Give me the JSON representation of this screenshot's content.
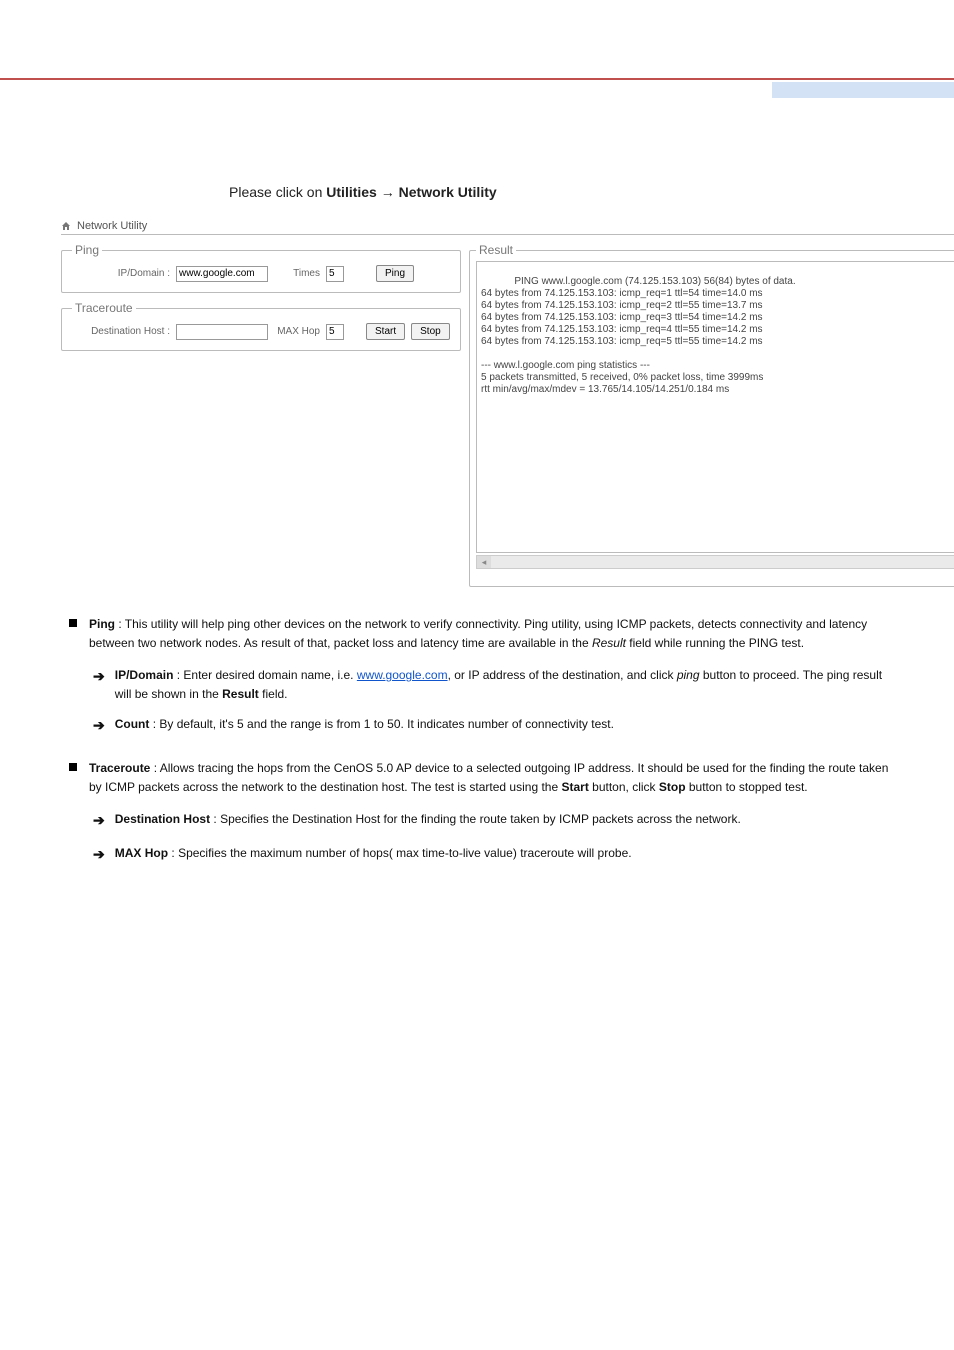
{
  "heading": {
    "prefix": "Please click on ",
    "path_bold_1": "Utilities",
    "arrow": " → ",
    "path_bold_2": "Network Utility"
  },
  "panel": {
    "title": "Network Utility",
    "ping": {
      "legend": "Ping",
      "ip_label": "IP/Domain :",
      "ip_value": "www.google.com",
      "times_label": "Times",
      "times_value": "5",
      "button": "Ping"
    },
    "trace": {
      "legend": "Traceroute",
      "host_label": "Destination Host :",
      "host_value": "",
      "maxhop_label": "MAX Hop",
      "maxhop_value": "5",
      "start": "Start",
      "stop": "Stop"
    },
    "result": {
      "legend": "Result",
      "text": "PING www.l.google.com (74.125.153.103) 56(84) bytes of data.\n64 bytes from 74.125.153.103: icmp_req=1 ttl=54 time=14.0 ms\n64 bytes from 74.125.153.103: icmp_req=2 ttl=55 time=13.7 ms\n64 bytes from 74.125.153.103: icmp_req=3 ttl=54 time=14.2 ms\n64 bytes from 74.125.153.103: icmp_req=4 ttl=55 time=14.2 ms\n64 bytes from 74.125.153.103: icmp_req=5 ttl=55 time=14.2 ms\n\n--- www.l.google.com ping statistics ---\n5 packets transmitted, 5 received, 0% packet loss, time 3999ms\nrtt min/avg/max/mdev = 13.765/14.105/14.251/0.184 ms"
    }
  },
  "prose": {
    "ping": {
      "label": "Ping",
      "body": " : This utility will help ping other devices on the network to verify connectivity. Ping utility, using ICMP packets, detects connectivity and latency between two network nodes. As result of that, packet loss and latency time are available in the ",
      "result_italic": "Result",
      "body2": " field while running the PING test.",
      "sub1_label": "IP/Domain",
      "sub1_body": " : Enter desired domain name, i.e. ",
      "sub1_link": "www.google.com",
      "sub1_body2": ", or IP address of the destination, and click ",
      "sub1_ping_italic": "ping",
      "sub1_body3": " button to proceed. The ping result will be shown in the ",
      "sub1_result_bold": "Result",
      "sub1_body4": " field.",
      "sub2_label": "Count",
      "sub2_body": " : By default, it's 5 and the range is from 1 to 50. It indicates number of connectivity test."
    },
    "trace": {
      "label": "Traceroute",
      "body": " : Allows tracing the hops from the CenOS 5.0 AP device to a selected outgoing IP address. It should be used for the finding the route taken by ICMP packets across the network to the destination host. The test is started using the ",
      "start_bold": "Start",
      "body2": " button, click ",
      "stop_bold": "Stop",
      "body3": " button to stopped test.",
      "sub1_label": "Destination Host",
      "sub1_body": " : Specifies the Destination Host for the finding the route taken by ICMP packets across the network.",
      "sub2_label": "MAX Hop",
      "sub2_body": " : Specifies the maximum number of hops( max time-to-live value) traceroute will probe."
    }
  }
}
